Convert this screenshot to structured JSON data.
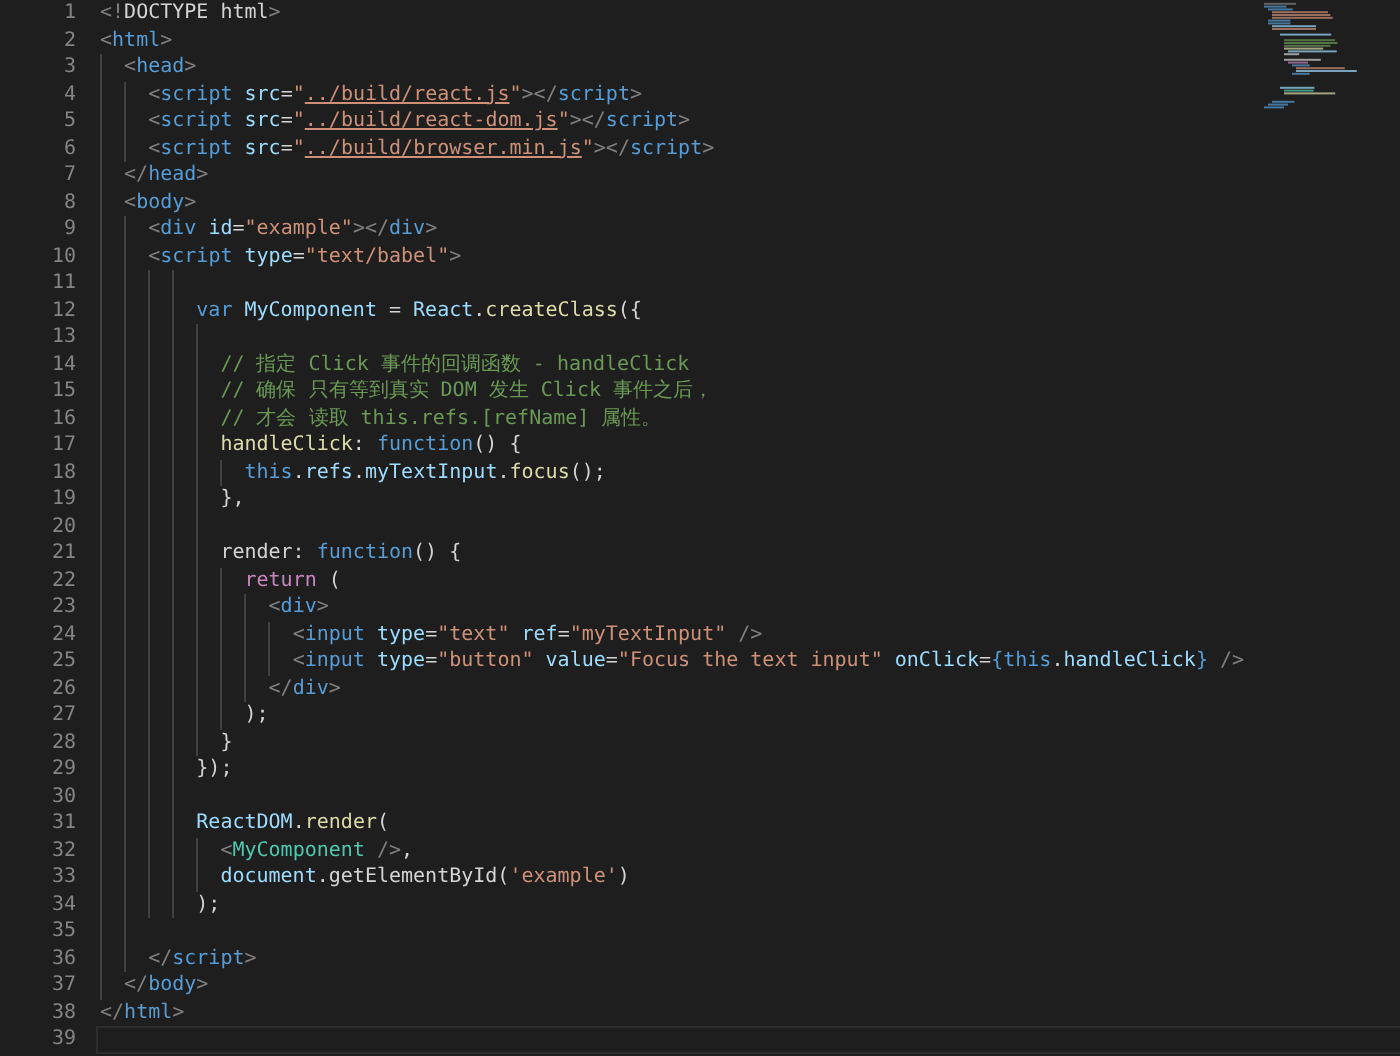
{
  "editor": {
    "lines": [
      {
        "number": "1",
        "current": false,
        "tokens": [
          {
            "kind": "punct",
            "text": "<!"
          },
          {
            "kind": "plain",
            "text": "DOCTYPE html"
          },
          {
            "kind": "punct",
            "text": ">"
          }
        ]
      },
      {
        "number": "2",
        "current": false,
        "tokens": [
          {
            "kind": "punct",
            "text": "<"
          },
          {
            "kind": "tag",
            "text": "html"
          },
          {
            "kind": "punct",
            "text": ">"
          }
        ]
      },
      {
        "number": "3",
        "current": false,
        "tokens": [
          {
            "kind": "punct",
            "text": "  <"
          },
          {
            "kind": "tag",
            "text": "head"
          },
          {
            "kind": "punct",
            "text": ">"
          }
        ]
      },
      {
        "number": "4",
        "current": false,
        "tokens": [
          {
            "kind": "punct",
            "text": "    <"
          },
          {
            "kind": "tag",
            "text": "script"
          },
          {
            "kind": "attr",
            "text": " src"
          },
          {
            "kind": "plain",
            "text": "="
          },
          {
            "kind": "string",
            "text": "\""
          },
          {
            "kind": "link",
            "text": "../build/react.js"
          },
          {
            "kind": "string",
            "text": "\""
          },
          {
            "kind": "punct",
            "text": "></"
          },
          {
            "kind": "tag",
            "text": "script"
          },
          {
            "kind": "punct",
            "text": ">"
          }
        ]
      },
      {
        "number": "5",
        "current": false,
        "tokens": [
          {
            "kind": "punct",
            "text": "    <"
          },
          {
            "kind": "tag",
            "text": "script"
          },
          {
            "kind": "attr",
            "text": " src"
          },
          {
            "kind": "plain",
            "text": "="
          },
          {
            "kind": "string",
            "text": "\""
          },
          {
            "kind": "link",
            "text": "../build/react-dom.js"
          },
          {
            "kind": "string",
            "text": "\""
          },
          {
            "kind": "punct",
            "text": "></"
          },
          {
            "kind": "tag",
            "text": "script"
          },
          {
            "kind": "punct",
            "text": ">"
          }
        ]
      },
      {
        "number": "6",
        "current": false,
        "tokens": [
          {
            "kind": "punct",
            "text": "    <"
          },
          {
            "kind": "tag",
            "text": "script"
          },
          {
            "kind": "attr",
            "text": " src"
          },
          {
            "kind": "plain",
            "text": "="
          },
          {
            "kind": "string",
            "text": "\""
          },
          {
            "kind": "link",
            "text": "../build/browser.min.js"
          },
          {
            "kind": "string",
            "text": "\""
          },
          {
            "kind": "punct",
            "text": "></"
          },
          {
            "kind": "tag",
            "text": "script"
          },
          {
            "kind": "punct",
            "text": ">"
          }
        ]
      },
      {
        "number": "7",
        "current": false,
        "tokens": [
          {
            "kind": "punct",
            "text": "  </"
          },
          {
            "kind": "tag",
            "text": "head"
          },
          {
            "kind": "punct",
            "text": ">"
          }
        ]
      },
      {
        "number": "8",
        "current": false,
        "tokens": [
          {
            "kind": "punct",
            "text": "  <"
          },
          {
            "kind": "tag",
            "text": "body"
          },
          {
            "kind": "punct",
            "text": ">"
          }
        ]
      },
      {
        "number": "9",
        "current": false,
        "tokens": [
          {
            "kind": "punct",
            "text": "    <"
          },
          {
            "kind": "tag",
            "text": "div"
          },
          {
            "kind": "attr",
            "text": " id"
          },
          {
            "kind": "plain",
            "text": "="
          },
          {
            "kind": "string",
            "text": "\"example\""
          },
          {
            "kind": "punct",
            "text": "></"
          },
          {
            "kind": "tag",
            "text": "div"
          },
          {
            "kind": "punct",
            "text": ">"
          }
        ]
      },
      {
        "number": "10",
        "current": false,
        "tokens": [
          {
            "kind": "punct",
            "text": "    <"
          },
          {
            "kind": "tag",
            "text": "script"
          },
          {
            "kind": "attr",
            "text": " type"
          },
          {
            "kind": "plain",
            "text": "="
          },
          {
            "kind": "string",
            "text": "\"text/babel\""
          },
          {
            "kind": "punct",
            "text": ">"
          }
        ]
      },
      {
        "number": "11",
        "current": false
      },
      {
        "number": "12",
        "current": false,
        "tokens": [
          {
            "kind": "keyword",
            "text": "        var"
          },
          {
            "kind": "variable",
            "text": " MyComponent"
          },
          {
            "kind": "plain",
            "text": " = "
          },
          {
            "kind": "variable",
            "text": "React"
          },
          {
            "kind": "plain",
            "text": "."
          },
          {
            "kind": "function",
            "text": "createClass"
          },
          {
            "kind": "plain",
            "text": "({"
          }
        ]
      },
      {
        "number": "13",
        "current": false
      },
      {
        "number": "14",
        "current": false,
        "tokens": [
          {
            "kind": "comment",
            "text": "          // 指定 Click 事件的回调函数 - handleClick"
          }
        ]
      },
      {
        "number": "15",
        "current": false,
        "tokens": [
          {
            "kind": "comment",
            "text": "          // 确保 只有等到真实 DOM 发生 Click 事件之后，"
          }
        ]
      },
      {
        "number": "16",
        "current": false,
        "tokens": [
          {
            "kind": "comment",
            "text": "          // 才会 读取 this.refs.[refName] 属性。"
          }
        ]
      },
      {
        "number": "17",
        "current": false,
        "tokens": [
          {
            "kind": "function",
            "text": "          handleClick"
          },
          {
            "kind": "plain",
            "text": ": "
          },
          {
            "kind": "keyword",
            "text": "function"
          },
          {
            "kind": "plain",
            "text": "() {"
          }
        ]
      },
      {
        "number": "18",
        "current": false,
        "tokens": [
          {
            "kind": "keyword",
            "text": "            this"
          },
          {
            "kind": "plain",
            "text": "."
          },
          {
            "kind": "variable",
            "text": "refs"
          },
          {
            "kind": "plain",
            "text": "."
          },
          {
            "kind": "variable",
            "text": "myTextInput"
          },
          {
            "kind": "plain",
            "text": "."
          },
          {
            "kind": "function",
            "text": "focus"
          },
          {
            "kind": "plain",
            "text": "();"
          }
        ]
      },
      {
        "number": "19",
        "current": false,
        "tokens": [
          {
            "kind": "plain",
            "text": "          },"
          }
        ]
      },
      {
        "number": "20",
        "current": false
      },
      {
        "number": "21",
        "current": false,
        "tokens": [
          {
            "kind": "plain",
            "text": "          render: "
          },
          {
            "kind": "keyword",
            "text": "function"
          },
          {
            "kind": "plain",
            "text": "() {"
          }
        ]
      },
      {
        "number": "22",
        "current": false,
        "tokens": [
          {
            "kind": "control",
            "text": "            return"
          },
          {
            "kind": "plain",
            "text": " ("
          }
        ]
      },
      {
        "number": "23",
        "current": false,
        "tokens": [
          {
            "kind": "punct",
            "text": "              <"
          },
          {
            "kind": "tag",
            "text": "div"
          },
          {
            "kind": "punct",
            "text": ">"
          }
        ]
      },
      {
        "number": "24",
        "current": false,
        "tokens": [
          {
            "kind": "punct",
            "text": "                <"
          },
          {
            "kind": "tag",
            "text": "input"
          },
          {
            "kind": "attr",
            "text": " type"
          },
          {
            "kind": "plain",
            "text": "="
          },
          {
            "kind": "string",
            "text": "\"text\""
          },
          {
            "kind": "attr",
            "text": " ref"
          },
          {
            "kind": "plain",
            "text": "="
          },
          {
            "kind": "string",
            "text": "\"myTextInput\""
          },
          {
            "kind": "punct",
            "text": " />"
          }
        ]
      },
      {
        "number": "25",
        "current": false,
        "tokens": [
          {
            "kind": "punct",
            "text": "                <"
          },
          {
            "kind": "tag",
            "text": "input"
          },
          {
            "kind": "attr",
            "text": " type"
          },
          {
            "kind": "plain",
            "text": "="
          },
          {
            "kind": "string",
            "text": "\"button\""
          },
          {
            "kind": "attr",
            "text": " value"
          },
          {
            "kind": "plain",
            "text": "="
          },
          {
            "kind": "string",
            "text": "\"Focus the text input\""
          },
          {
            "kind": "attr",
            "text": " onClick"
          },
          {
            "kind": "plain",
            "text": "="
          },
          {
            "kind": "keyword",
            "text": "{this"
          },
          {
            "kind": "plain",
            "text": "."
          },
          {
            "kind": "variable",
            "text": "handleClick"
          },
          {
            "kind": "keyword",
            "text": "}"
          },
          {
            "kind": "punct",
            "text": " />"
          }
        ]
      },
      {
        "number": "26",
        "current": false,
        "tokens": [
          {
            "kind": "punct",
            "text": "              </"
          },
          {
            "kind": "tag",
            "text": "div"
          },
          {
            "kind": "punct",
            "text": ">"
          }
        ]
      },
      {
        "number": "27",
        "current": false,
        "tokens": [
          {
            "kind": "plain",
            "text": "            );"
          }
        ]
      },
      {
        "number": "28",
        "current": false,
        "tokens": [
          {
            "kind": "plain",
            "text": "          }"
          }
        ]
      },
      {
        "number": "29",
        "current": false,
        "tokens": [
          {
            "kind": "plain",
            "text": "        });"
          }
        ]
      },
      {
        "number": "30",
        "current": false
      },
      {
        "number": "31",
        "current": false,
        "tokens": [
          {
            "kind": "variable",
            "text": "        ReactDOM"
          },
          {
            "kind": "plain",
            "text": "."
          },
          {
            "kind": "function",
            "text": "render"
          },
          {
            "kind": "plain",
            "text": "("
          }
        ]
      },
      {
        "number": "32",
        "current": false,
        "tokens": [
          {
            "kind": "punct",
            "text": "          <"
          },
          {
            "kind": "component",
            "text": "MyComponent"
          },
          {
            "kind": "punct",
            "text": " />"
          },
          {
            "kind": "plain",
            "text": ","
          }
        ]
      },
      {
        "number": "33",
        "current": false,
        "tokens": [
          {
            "kind": "variable",
            "text": "          document"
          },
          {
            "kind": "plain",
            "text": ".getElementById"
          },
          {
            "kind": "plain",
            "text": "("
          },
          {
            "kind": "string",
            "text": "'example'"
          },
          {
            "kind": "plain",
            "text": ")"
          }
        ]
      },
      {
        "number": "34",
        "current": false,
        "tokens": [
          {
            "kind": "plain",
            "text": "        );"
          }
        ]
      },
      {
        "number": "35",
        "current": false
      },
      {
        "number": "36",
        "current": false,
        "tokens": [
          {
            "kind": "punct",
            "text": "    </"
          },
          {
            "kind": "tag",
            "text": "script"
          },
          {
            "kind": "punct",
            "text": ">"
          }
        ]
      },
      {
        "number": "37",
        "current": false,
        "tokens": [
          {
            "kind": "punct",
            "text": "  </"
          },
          {
            "kind": "tag",
            "text": "body"
          },
          {
            "kind": "punct",
            "text": ">"
          }
        ]
      },
      {
        "number": "38",
        "current": false,
        "tokens": [
          {
            "kind": "punct",
            "text": "</"
          },
          {
            "kind": "tag",
            "text": "html"
          },
          {
            "kind": "punct",
            "text": ">"
          }
        ]
      },
      {
        "number": "39",
        "current": true
      }
    ]
  }
}
